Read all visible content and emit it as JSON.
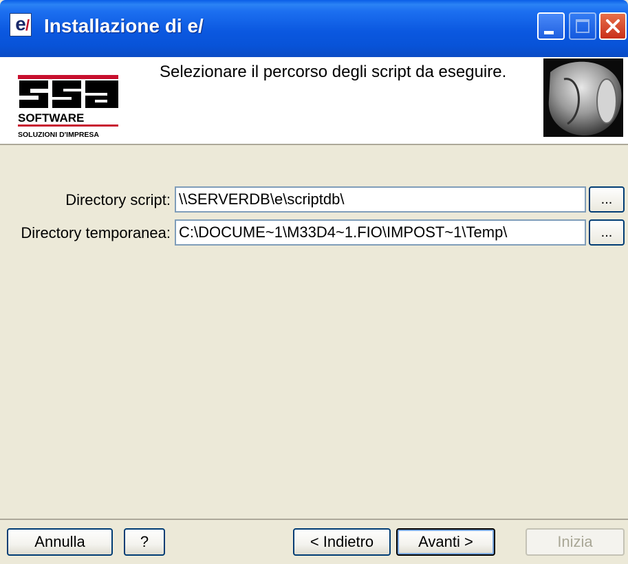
{
  "window": {
    "title": "Installazione di e/",
    "app_icon": "e-slash-app-icon"
  },
  "header": {
    "message": "Selezionare il percorso degli script da eseguire.",
    "logo": {
      "brand": "esa",
      "line1": "SOFTWARE",
      "line2": "SOLUZIONI D'IMPRESA"
    }
  },
  "fields": {
    "script": {
      "label": "Directory script:",
      "value": "\\\\SERVERDB\\e\\scriptdb\\",
      "browse_label": "..."
    },
    "temp": {
      "label": "Directory temporanea:",
      "value": "C:\\DOCUME~1\\M33D4~1.FIO\\IMPOST~1\\Temp\\",
      "browse_label": "..."
    }
  },
  "buttons": {
    "cancel": "Annulla",
    "help": "?",
    "back": "< Indietro",
    "next": "Avanti >",
    "start": "Inizia"
  },
  "colors": {
    "titlebar": "#0853d8",
    "dialog_bg": "#ece9d8",
    "logo_red": "#c8102e"
  }
}
